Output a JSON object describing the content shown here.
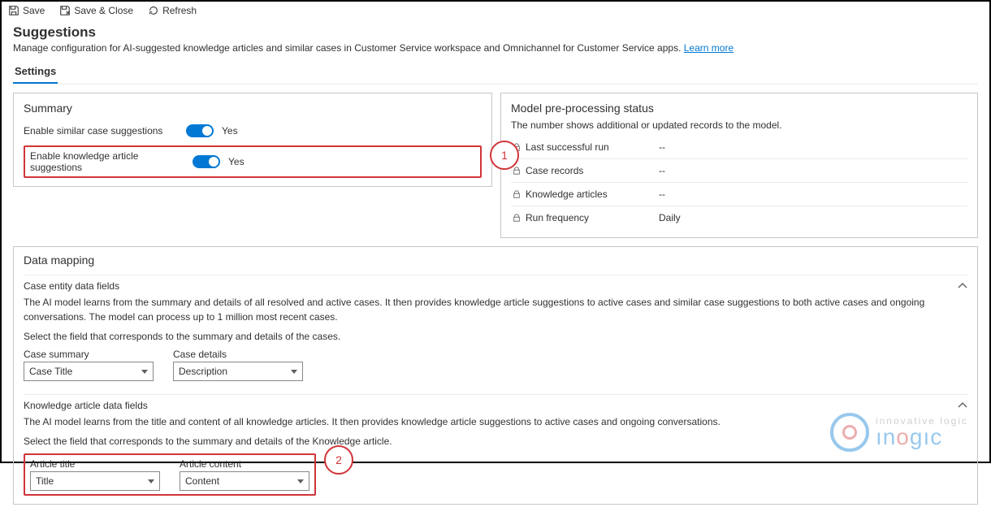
{
  "cmdbar": {
    "save": "Save",
    "save_close": "Save & Close",
    "refresh": "Refresh"
  },
  "page": {
    "title": "Suggestions",
    "subtitle": "Manage configuration for AI-suggested knowledge articles and similar cases in Customer Service workspace and Omnichannel for Customer Service apps.",
    "learn_more": "Learn more",
    "tab": "Settings"
  },
  "summary": {
    "heading": "Summary",
    "row1_label": "Enable similar case suggestions",
    "row1_value": "Yes",
    "row2_label": "Enable knowledge article suggestions",
    "row2_value": "Yes",
    "annot1": "1"
  },
  "status": {
    "heading": "Model pre-processing status",
    "sub": "The number shows additional or updated records to the model.",
    "rows": [
      {
        "label": "Last successful run",
        "value": "--"
      },
      {
        "label": "Case records",
        "value": "--"
      },
      {
        "label": "Knowledge articles",
        "value": "--"
      },
      {
        "label": "Run frequency",
        "value": "Daily"
      }
    ]
  },
  "dm": {
    "heading": "Data mapping",
    "case": {
      "title": "Case entity data fields",
      "help1": "The AI model learns from the summary and details of all resolved and active cases. It then provides knowledge article suggestions to active cases and similar case suggestions to both active cases and ongoing conversations. The model can process up to 1 million most recent cases.",
      "help2": "Select the field that corresponds to the summary and details of the cases.",
      "f1_label": "Case summary",
      "f1_value": "Case Title",
      "f2_label": "Case details",
      "f2_value": "Description"
    },
    "ka": {
      "title": "Knowledge article data fields",
      "help1": "The AI model learns from the title and content of all knowledge articles. It then provides knowledge article suggestions to active cases and ongoing conversations.",
      "help2": "Select the field that corresponds to the summary and details of the Knowledge article.",
      "f1_label": "Article title",
      "f1_value": "Title",
      "f2_label": "Article content",
      "f2_value": "Content",
      "annot2": "2"
    }
  },
  "watermark": {
    "top": "innovative logic",
    "bot_left": "ın",
    "bot_mid": "o",
    "bot_right": "gıc"
  }
}
